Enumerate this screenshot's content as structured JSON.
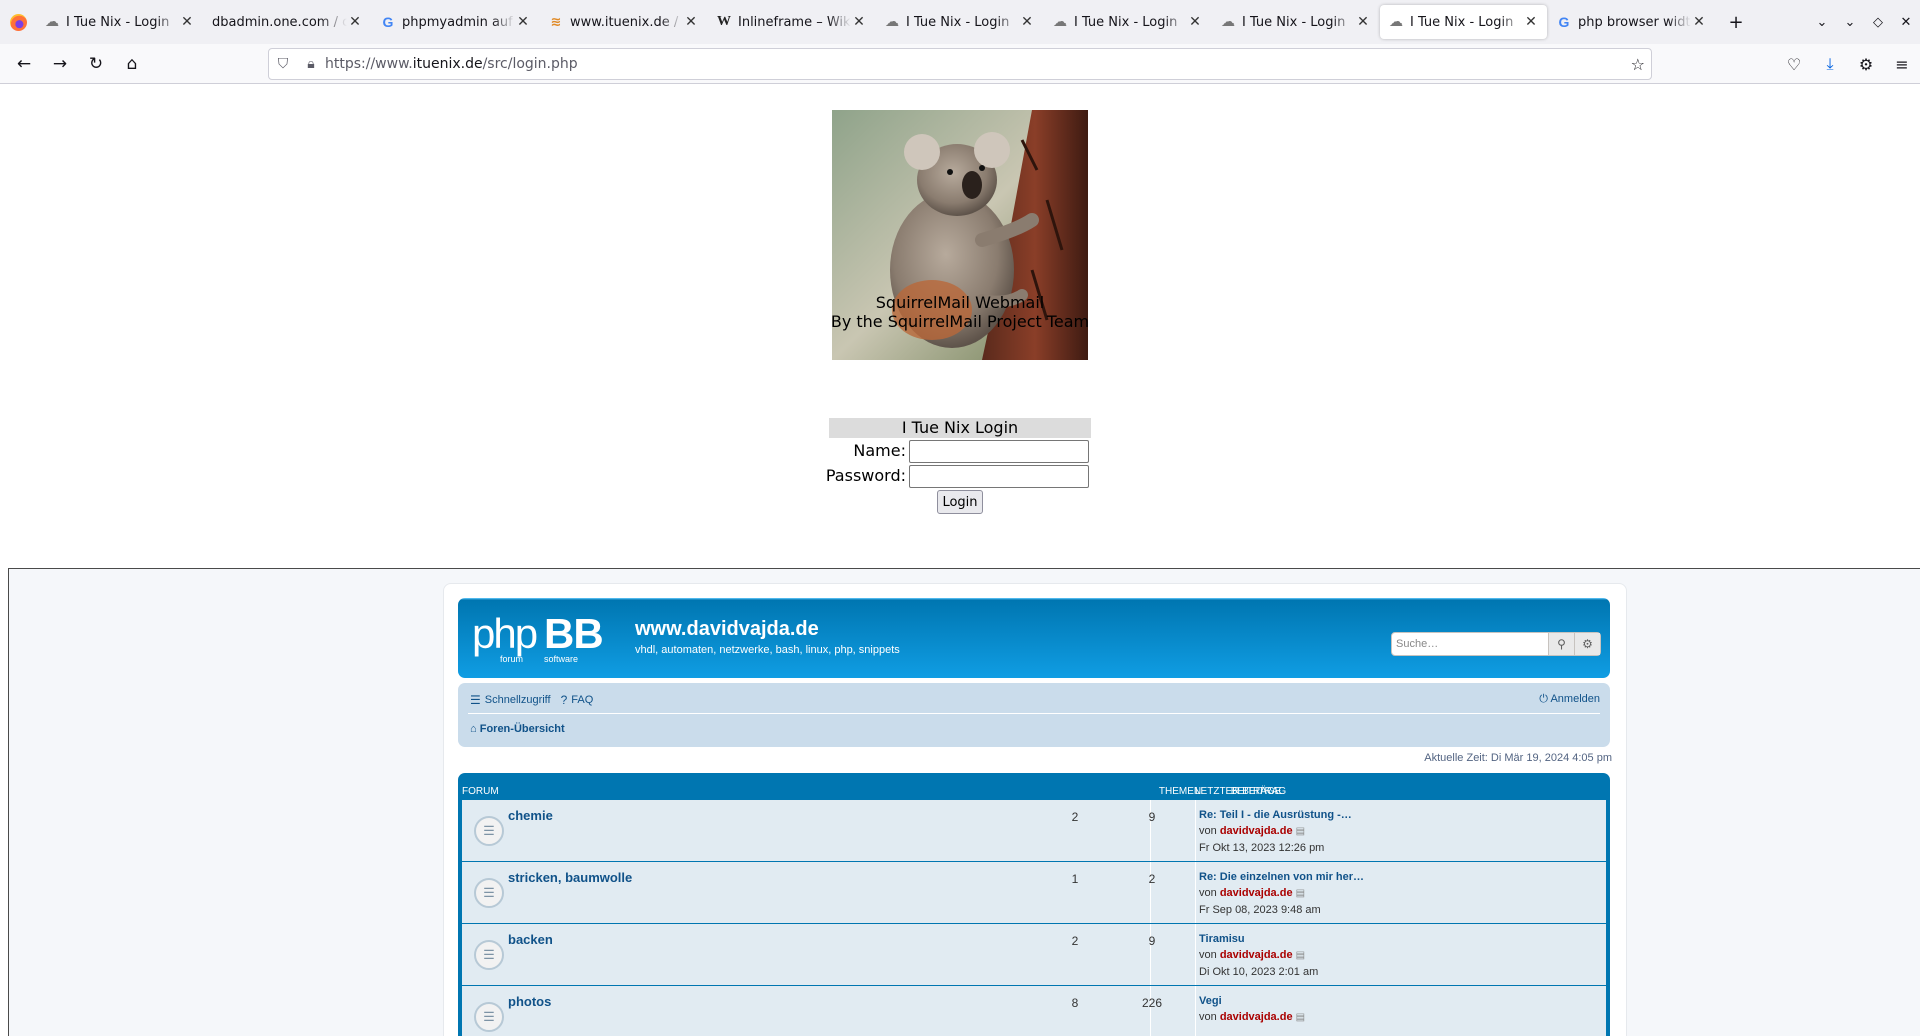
{
  "tabs": [
    {
      "title": "I Tue Nix - Login",
      "favicon": "squirrel-icon",
      "active": false
    },
    {
      "title": "dbadmin.one.com / c",
      "favicon": "",
      "active": false
    },
    {
      "title": "phpmyadmin auf",
      "favicon": "google-icon",
      "active": false
    },
    {
      "title": "www.ituenix.de /",
      "favicon": "wave-icon",
      "active": false
    },
    {
      "title": "Inlineframe – Wiki",
      "favicon": "wikipedia-icon",
      "active": false
    },
    {
      "title": "I Tue Nix - Login",
      "favicon": "squirrel-icon",
      "active": false
    },
    {
      "title": "I Tue Nix - Login",
      "favicon": "squirrel-icon",
      "active": false
    },
    {
      "title": "I Tue Nix - Login",
      "favicon": "squirrel-icon",
      "active": false
    },
    {
      "title": "I Tue Nix - Login",
      "favicon": "squirrel-icon",
      "active": true
    },
    {
      "title": "php browser width",
      "favicon": "google-icon",
      "active": false
    }
  ],
  "url": {
    "prefix": "https://www.",
    "domain": "ituenix.de",
    "path": "/src/login.php"
  },
  "squirrelmail": {
    "line1": "SquirrelMail Webmail",
    "line2": "By the SquirrelMail Project Team",
    "login_heading": "I Tue Nix Login",
    "name_label": "Name:",
    "password_label": "Password:",
    "login_button": "Login",
    "name_value": "",
    "password_value": ""
  },
  "phpbb": {
    "site_title": "www.davidvajda.de",
    "site_desc": "vhdl, automaten, netzwerke, bash, linux, php, snippets",
    "search_placeholder": "Suche…",
    "quicklinks": "Schnellzugriff",
    "faq": "FAQ",
    "login": "Anmelden",
    "breadcrumb": "Foren-Übersicht",
    "current_time": "Aktuelle Zeit: Di Mär 19, 2024 4:05 pm",
    "columns": {
      "forum": "Forum",
      "topics": "Themen",
      "posts": "Beiträge",
      "last_post": "Letzter Beitrag"
    },
    "forums": [
      {
        "name": "chemie",
        "topics": "2",
        "posts": "9",
        "last_title": "Re: Teil I - die Ausrüstung -…",
        "by_prefix": "von",
        "last_by": "davidvajda.de",
        "last_date": "Fr Okt 13, 2023 12:26 pm"
      },
      {
        "name": "stricken, baumwolle",
        "topics": "1",
        "posts": "2",
        "last_title": "Re: Die einzelnen von mir her…",
        "by_prefix": "von",
        "last_by": "davidvajda.de",
        "last_date": "Fr Sep 08, 2023 9:48 am"
      },
      {
        "name": "backen",
        "topics": "2",
        "posts": "9",
        "last_title": "Tiramisu",
        "by_prefix": "von",
        "last_by": "davidvajda.de",
        "last_date": "Di Okt 10, 2023 2:01 am"
      },
      {
        "name": "photos",
        "topics": "8",
        "posts": "226",
        "last_title": "Vegi",
        "by_prefix": "von",
        "last_by": "davidvajda.de",
        "last_date": ""
      }
    ]
  }
}
